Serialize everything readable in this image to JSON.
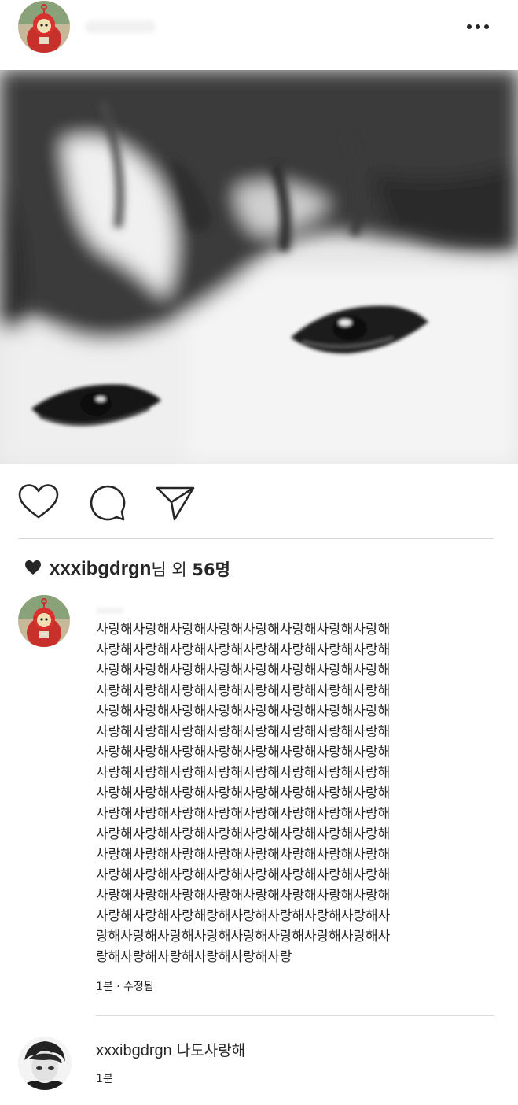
{
  "post": {
    "header": {
      "avatar_icon": "teletubby-avatar-icon",
      "more_icon": "more-options-icon"
    },
    "image": {
      "description_icon": "photo-image"
    },
    "actions": {
      "like_icon": "heart-outline-icon",
      "comment_icon": "comment-bubble-icon",
      "share_icon": "paper-plane-icon"
    },
    "likes": {
      "heart_icon": "heart-filled-icon",
      "user": "xxxibgdrgn",
      "suffix_nim": "님",
      "suffix_oe": " 외 ",
      "count": "56명"
    },
    "caption": {
      "text": "사랑해사랑해사랑해사랑해사랑해사랑해사랑해사랑해\n사랑해사랑해사랑해사랑해사랑해사랑해사랑해사랑해\n사랑해사랑해사랑해사랑해사랑해사랑해사랑해사랑해\n사랑해사랑해사랑해사랑해사랑해사랑해사랑해사랑해\n사랑해사랑해사랑해사랑해사랑해사랑해사랑해사랑해\n사랑해사랑해사랑해사랑해사랑해사랑해사랑해사랑해\n사랑해사랑해사랑해사랑해사랑해사랑해사랑해사랑해\n사랑해사랑해사랑해사랑해사랑해사랑해사랑해사랑해\n사랑해사랑해사랑해사랑해사랑해사랑해사랑해사랑해\n사랑해사랑해사랑해사랑해사랑해사랑해사랑해사랑해\n사랑해사랑해사랑해사랑해사랑해사랑해사랑해사랑해\n사랑해사랑해사랑해사랑해사랑해사랑해사랑해사랑해\n사랑해사랑해사랑해사랑해사랑해사랑해사랑해사랑해\n사랑해사랑해사랑해사랑해사랑해사랑해사랑해사랑해\n사랑해사랑해사랑해랑해사랑해사랑해사랑해사랑해사\n랑해사랑해사랑해사랑해사랑해사랑해사랑해사랑해사\n랑해사랑해사랑해사랑해사랑해사랑",
      "meta": "1분 · 수정됨"
    },
    "reply": {
      "avatar_icon": "user-avatar",
      "user": "xxxibgdrgn",
      "text": " 나도사랑해",
      "meta": "1분"
    }
  }
}
